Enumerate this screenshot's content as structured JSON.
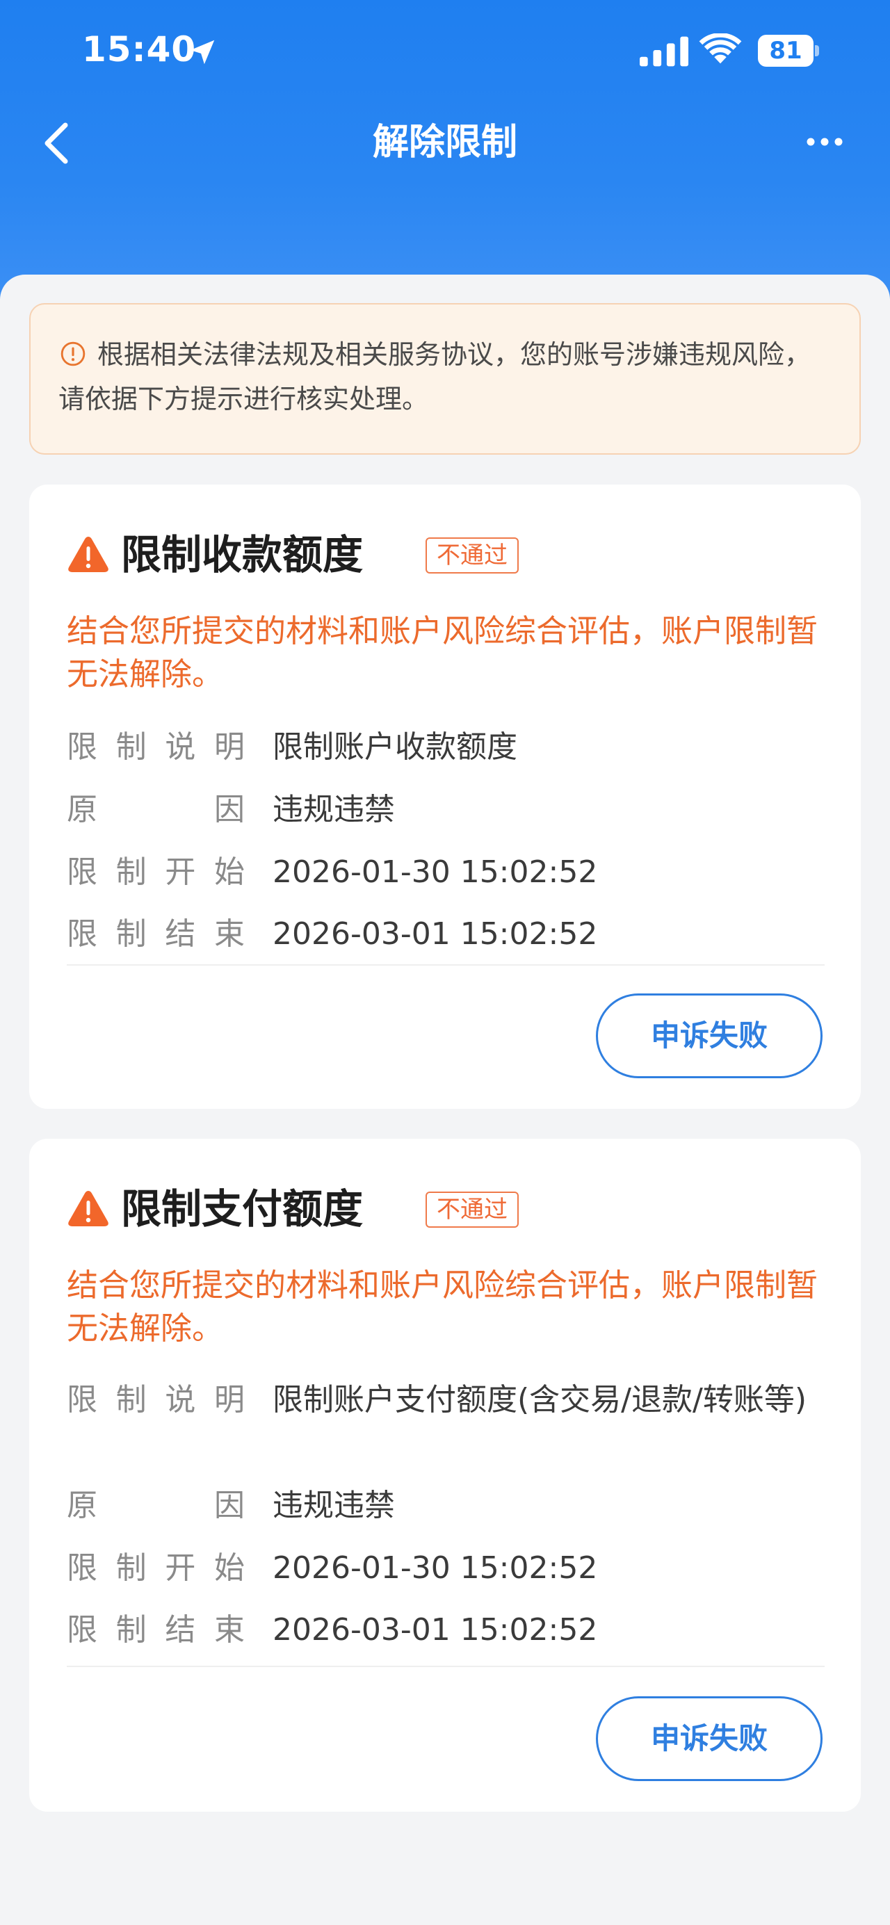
{
  "status_bar": {
    "time": "15:40",
    "battery": "81",
    "icons": [
      "location-arrow-icon",
      "cellular-signal-icon",
      "wifi-icon",
      "battery-icon"
    ]
  },
  "nav": {
    "title": "解除限制",
    "back_icon": "chevron-left-icon",
    "more_icon": "more-dots-icon"
  },
  "notice": {
    "icon": "info-circle-icon",
    "text": "根据相关法律法规及相关服务协议，您的账号涉嫌违规风险，请依据下方提示进行核实处理。"
  },
  "cards": [
    {
      "title": "限制收款额度",
      "badge": "不通过",
      "description": "结合您所提交的材料和账户风险综合评估，账户限制暂无法解除。",
      "rows": [
        {
          "label": "限制说明",
          "value": "限制账户收款额度"
        },
        {
          "label": "原因",
          "value": "违规违禁"
        },
        {
          "label": "限制开始",
          "value": "2026-01-30 15:02:52"
        },
        {
          "label": "限制结束",
          "value": "2026-03-01 15:02:52"
        }
      ],
      "button": "申诉失败"
    },
    {
      "title": "限制支付额度",
      "badge": "不通过",
      "description": "结合您所提交的材料和账户风险综合评估，账户限制暂无法解除。",
      "rows": [
        {
          "label": "限制说明",
          "value": "限制账户支付额度(含交易/退款/转账等)"
        },
        {
          "label": "原因",
          "value": "违规违禁"
        },
        {
          "label": "限制开始",
          "value": "2026-01-30 15:02:52"
        },
        {
          "label": "限制结束",
          "value": "2026-03-01 15:02:52"
        }
      ],
      "button": "申诉失败"
    }
  ],
  "colors": {
    "header_blue": "#1f7ff0",
    "warning_orange": "#ec6a2c",
    "button_blue": "#2f7fe0",
    "notice_bg": "#fdf3e8"
  }
}
